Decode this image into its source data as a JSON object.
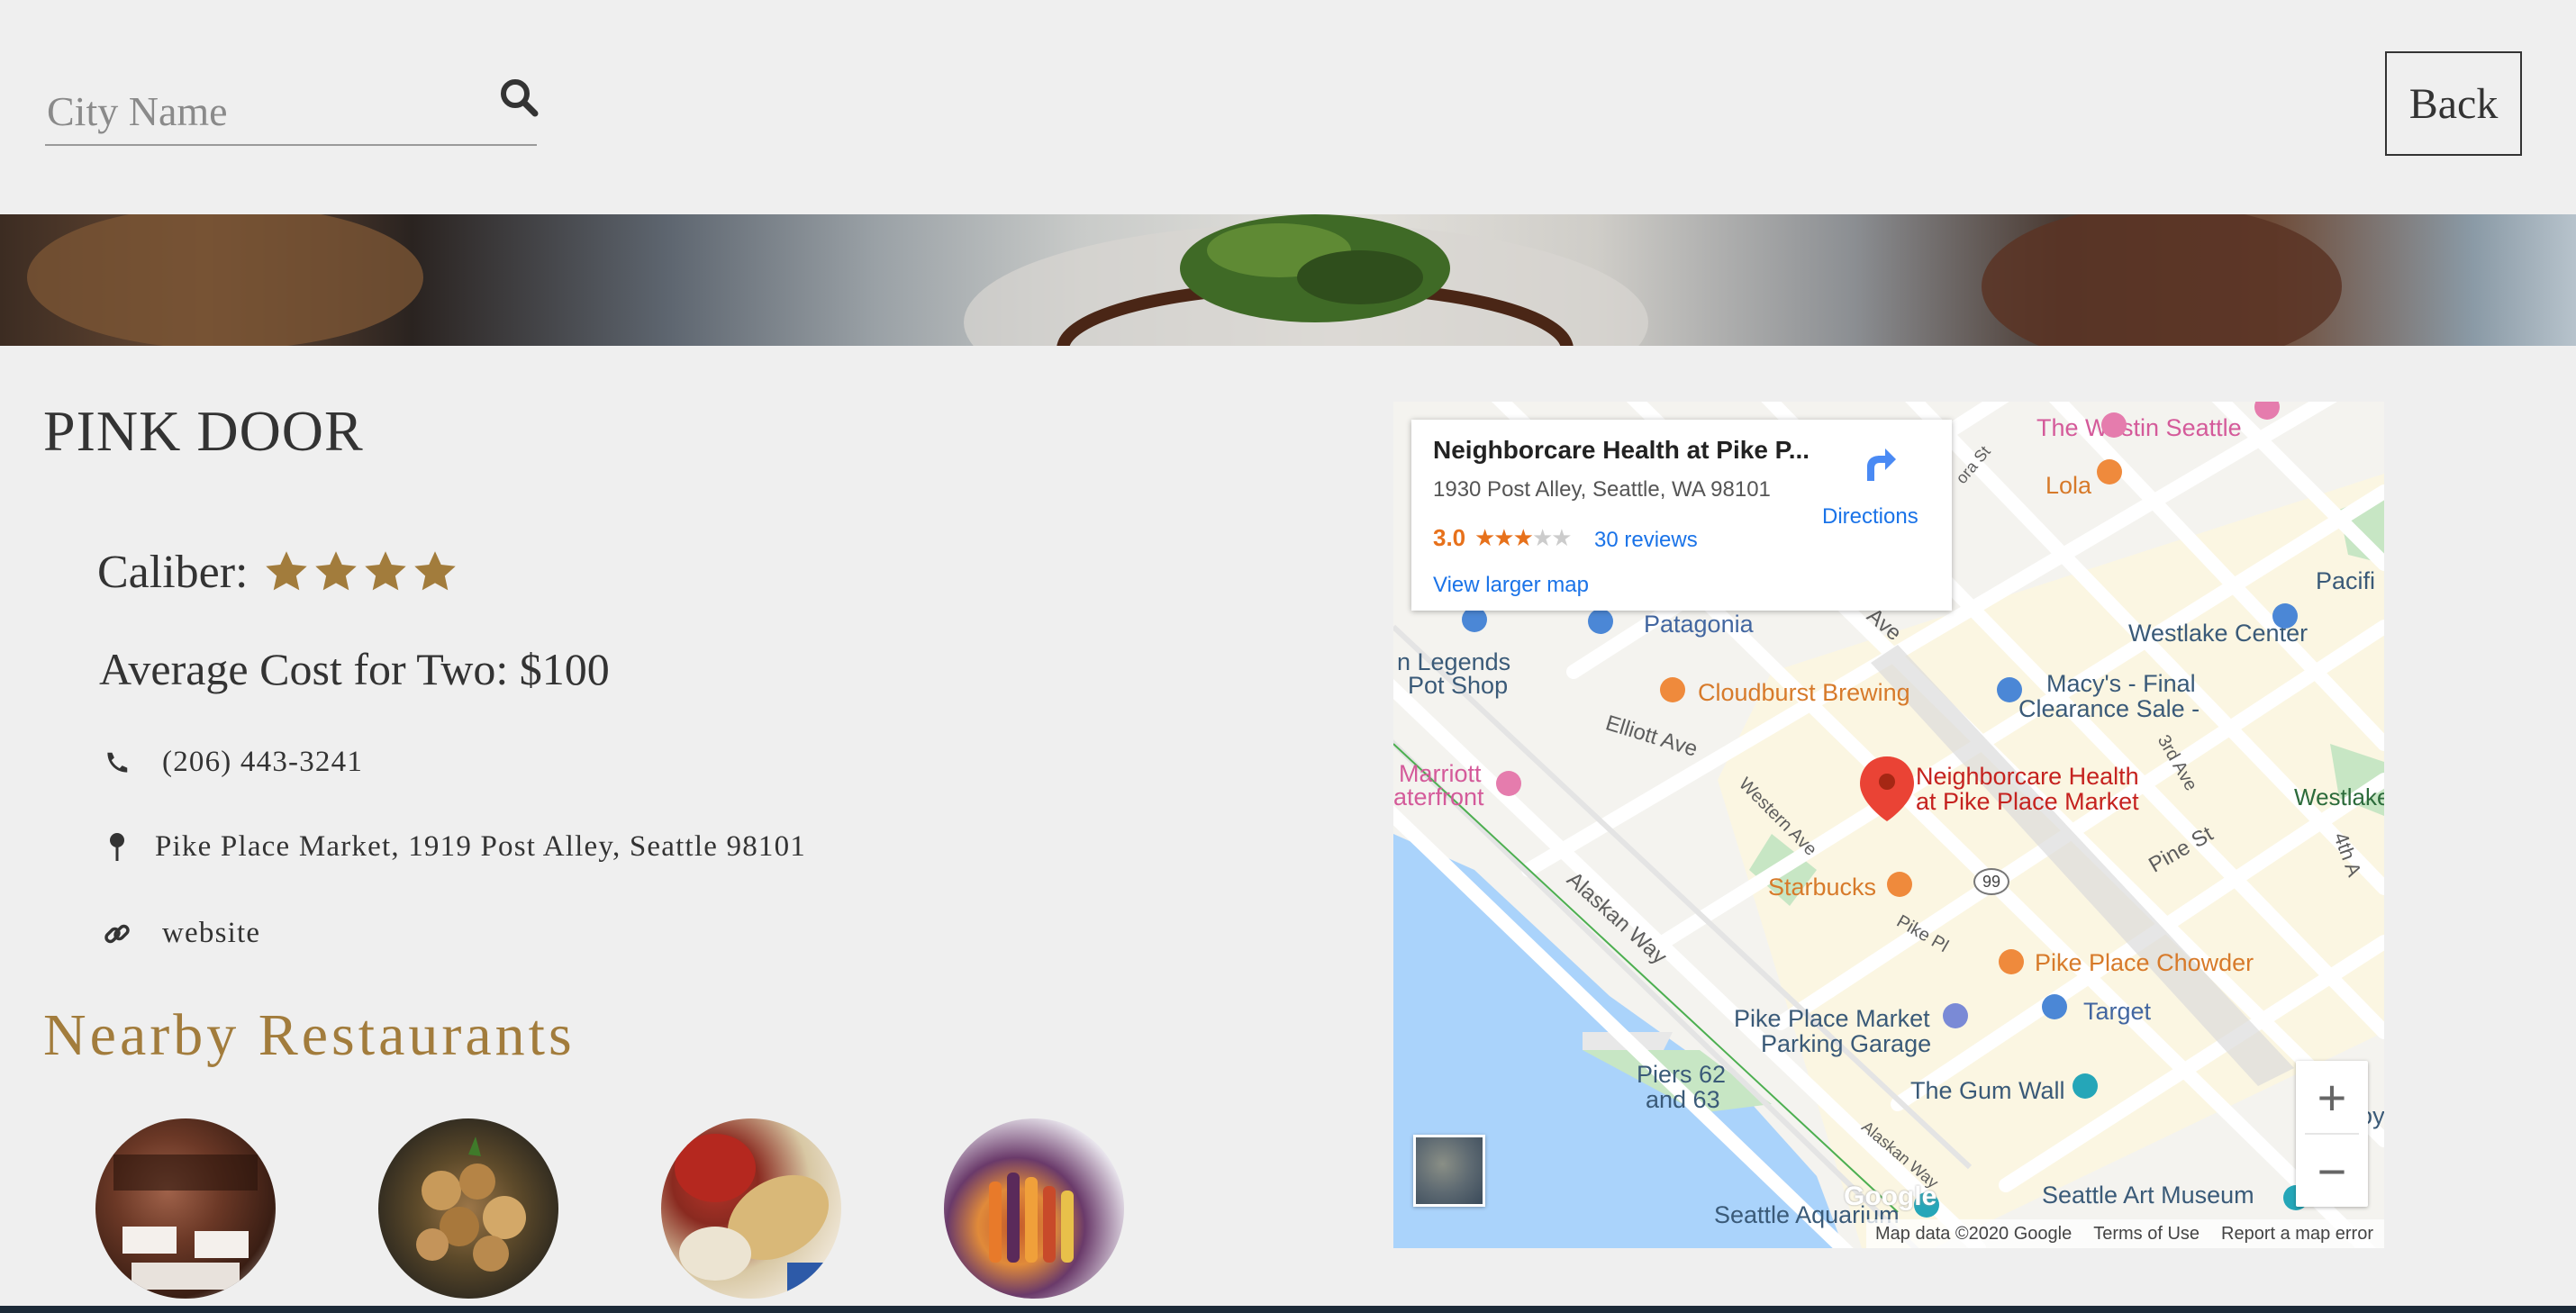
{
  "header": {
    "search_placeholder": "City Name",
    "back_label": "Back"
  },
  "restaurant": {
    "name": "PINK DOOR",
    "caliber_label": "Caliber:",
    "caliber_stars": 4,
    "avg_cost": "Average Cost for Two: $100",
    "phone": "(206) 443-3241",
    "address": "Pike Place Market, 1919 Post Alley, Seattle 98101",
    "website": "website"
  },
  "nearby": {
    "title": "Nearby Restaurants",
    "count": 4
  },
  "map": {
    "card": {
      "title": "Neighborcare Health at Pike P...",
      "address": "1930 Post Alley, Seattle, WA 98101",
      "rating": "3.0",
      "rating_stars": 3,
      "reviews": "30 reviews",
      "larger_map": "View larger map",
      "directions": "Directions"
    },
    "labels": {
      "westin": "The Westin Seattle",
      "lola": "Lola",
      "pacific": "Pacifi",
      "westlake_center": "Westlake Center",
      "patagonia": "Patagonia",
      "legends_1": "n Legends",
      "legends_2": "Pot Shop",
      "cloudburst": "Cloudburst Brewing",
      "macys_1": "Macy's - Final",
      "macys_2": "Clearance Sale -",
      "elliott": "Elliott Ave",
      "marriott_1": "Marriott",
      "marriott_2": "aterfront",
      "neighborcare_1": "Neighborcare Health",
      "neighborcare_2": "at Pike Place Market",
      "westlake": "Westlake",
      "western": "Western Ave",
      "starbucks": "Starbucks",
      "pine": "Pine St",
      "alaskan": "Alaskan Way",
      "pike_pl": "Pike Pl",
      "chowder": "Pike Place Chowder",
      "target": "Target",
      "parking_1": "Pike Place Market",
      "parking_2": "Parking Garage",
      "piers_1": "Piers 62",
      "piers_2": "and 63",
      "gum_wall": "The Gum Wall",
      "benaroya": "Benaroy",
      "art_museum": "Seattle Art Museum",
      "aquarium": "Seattle Aquarium",
      "third_ave": "3rd Ave",
      "fourth": "4th A",
      "ave": "Ave",
      "route": "99",
      "alaskan_small": "Alaskan Way",
      "st_small": "ora St"
    },
    "zoom_in": "+",
    "zoom_out": "−",
    "google": "Google",
    "attribution": {
      "data": "Map data ©2020 Google",
      "terms": "Terms of Use",
      "report": "Report a map error"
    }
  },
  "colors": {
    "background": "#efefef",
    "star": "#a27c3c",
    "nearby_title": "#a27c3c",
    "map_link": "#1a73e8",
    "map_pin": "#ea4335"
  },
  "icons": {
    "search": "search-icon",
    "phone": "phone-icon",
    "address": "map-pin-icon",
    "website": "link-icon"
  }
}
